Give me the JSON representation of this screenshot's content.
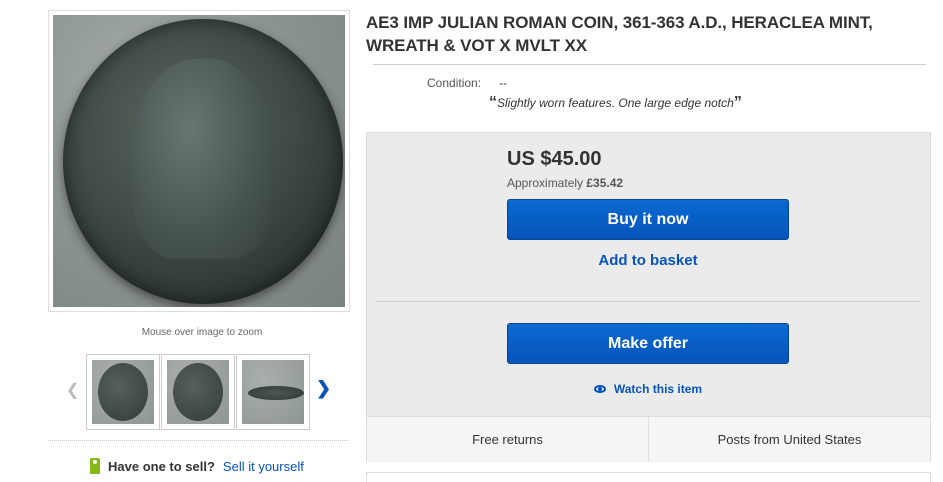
{
  "gallery": {
    "zoom_hint": "Mouse over image to zoom",
    "prev_icon": "chevron-left-icon",
    "next_icon": "chevron-right-icon",
    "thumbnails": [
      "coin-obverse",
      "coin-reverse",
      "coin-edge"
    ]
  },
  "sell": {
    "question": "Have one to sell?",
    "link": "Sell it yourself"
  },
  "listing": {
    "title": "AE3 IMP JULIAN ROMAN COIN, 361-363 A.D., HERACLEA MINT, WREATH & VOT X MVLT XX",
    "condition_label": "Condition:",
    "condition_value": "--",
    "condition_note": "Slightly worn features. One large edge notch",
    "open_quote": "“",
    "close_quote": "”"
  },
  "buy_box": {
    "price": "US $45.00",
    "approx_prefix": "Approximately ",
    "approx_value": "£35.42",
    "buy_now": "Buy it now",
    "add_to_basket": "Add to basket",
    "make_offer": "Make offer",
    "watch": "Watch this item"
  },
  "footer": {
    "returns": "Free returns",
    "shipping": "Posts from United States"
  },
  "colors": {
    "link": "#0654ba",
    "button": "#0654ba",
    "sell_tag": "#86b817"
  }
}
